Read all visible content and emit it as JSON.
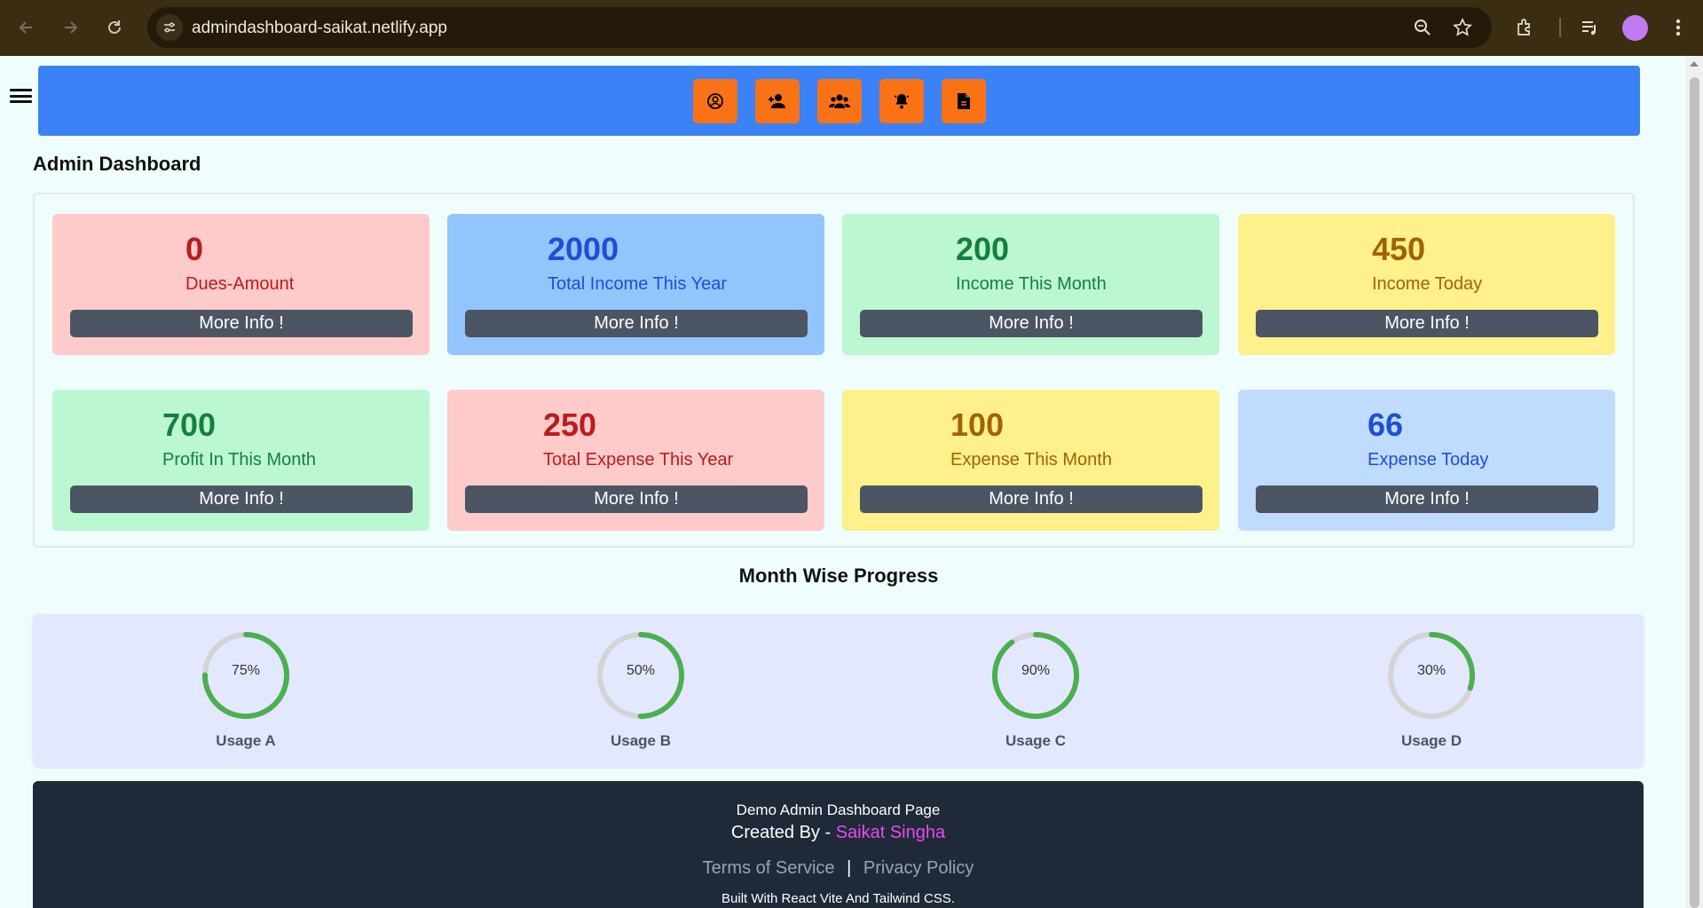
{
  "browser": {
    "url": "admindashboard-saikat.netlify.app",
    "back_icon": "arrow-left-icon",
    "forward_icon": "arrow-right-icon",
    "reload_icon": "reload-icon"
  },
  "topbar": {
    "color": "#3b82f6",
    "button_color": "#f97316",
    "icons": [
      "user-circle-icon",
      "add-user-icon",
      "users-group-icon",
      "bell-icon",
      "document-icon"
    ]
  },
  "page": {
    "title": "Admin Dashboard"
  },
  "cards": [
    {
      "value": "0",
      "label": "Dues-Amount",
      "button": "More Info !",
      "bg": "#fecaca",
      "fg": "#b91c1c"
    },
    {
      "value": "2000",
      "label": "Total Income This Year",
      "button": "More Info !",
      "bg": "#93c5fd",
      "fg": "#1d4ed8"
    },
    {
      "value": "200",
      "label": "Income This Month",
      "button": "More Info !",
      "bg": "#bbf7d0",
      "fg": "#15803d"
    },
    {
      "value": "450",
      "label": "Income Today",
      "button": "More Info !",
      "bg": "#fef08a",
      "fg": "#a16207"
    },
    {
      "value": "700",
      "label": "Profit In This Month",
      "button": "More Info !",
      "bg": "#bbf7d0",
      "fg": "#15803d"
    },
    {
      "value": "250",
      "label": "Total Expense This Year",
      "button": "More Info !",
      "bg": "#fecaca",
      "fg": "#b91c1c"
    },
    {
      "value": "100",
      "label": "Expense This Month",
      "button": "More Info !",
      "bg": "#fef08a",
      "fg": "#a16207"
    },
    {
      "value": "66",
      "label": "Expense Today",
      "button": "More Info !",
      "bg": "#bfdbfe",
      "fg": "#1d4ed8"
    }
  ],
  "progress": {
    "title": "Month Wise Progress",
    "items": [
      {
        "label": "Usage A",
        "percent": 75,
        "text": "75%"
      },
      {
        "label": "Usage B",
        "percent": 50,
        "text": "50%"
      },
      {
        "label": "Usage C",
        "percent": 90,
        "text": "90%"
      },
      {
        "label": "Usage D",
        "percent": 30,
        "text": "30%"
      }
    ],
    "track_color": "#d4d4d4",
    "fill_color": "#4caf50"
  },
  "footer": {
    "line1": "Demo Admin Dashboard Page",
    "created_by": "Created By -",
    "author": "Saikat Singha",
    "terms": "Terms of Service",
    "separator": "|",
    "privacy": "Privacy Policy",
    "built_with": "Built With React Vite And Tailwind CSS."
  }
}
